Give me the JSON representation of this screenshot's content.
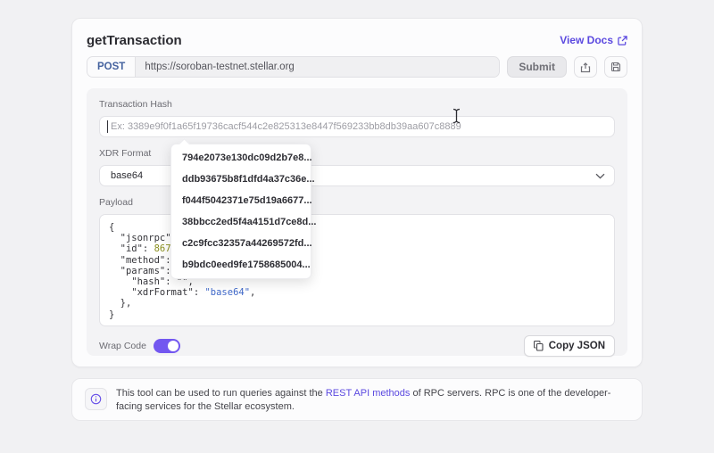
{
  "header": {
    "title": "getTransaction",
    "view_docs_label": "View Docs"
  },
  "request_bar": {
    "method": "POST",
    "url": "https://soroban-testnet.stellar.org",
    "submit_label": "Submit"
  },
  "form": {
    "transaction_hash": {
      "label": "Transaction Hash",
      "value": "",
      "placeholder": "Ex: 3389e9f0f1a65f19736cacf544c2e825313e8447f569233bb8db39aa607c8889"
    },
    "suggestions": [
      "794e2073e130dc09d2b7e8...",
      "ddb93675b8f1dfd4a37c36e...",
      "f044f5042371e75d19a6677...",
      "38bbcc2ed5f4a4151d7ce8d...",
      "c2c9fcc32357a44269572fd...",
      "b9bdc0eed9fe1758685004..."
    ],
    "xdr_format": {
      "label": "XDR Format",
      "value": "base64"
    },
    "payload": {
      "label": "Payload",
      "lines": [
        [
          {
            "c": "p",
            "v": "{"
          }
        ],
        [
          {
            "c": "p",
            "v": "  \"jsonrpc\": "
          }
        ],
        [
          {
            "c": "p",
            "v": "  \"id\": "
          },
          {
            "c": "num",
            "v": "86753"
          }
        ],
        [
          {
            "c": "p",
            "v": "  \"method\": \""
          }
        ],
        [
          {
            "c": "p",
            "v": "  \"params\": {"
          }
        ],
        [
          {
            "c": "p",
            "v": "    \"hash\": \"\","
          }
        ],
        [
          {
            "c": "p",
            "v": "    \"xdrFormat\": "
          },
          {
            "c": "str",
            "v": "\"base64\""
          },
          {
            "c": "p",
            "v": ","
          }
        ],
        [
          {
            "c": "p",
            "v": "  },"
          }
        ],
        [
          {
            "c": "p",
            "v": "}"
          }
        ]
      ]
    },
    "wrap_code_label": "Wrap Code",
    "wrap_code_on": true,
    "copy_json_label": "Copy JSON"
  },
  "footer_note": {
    "text_before_link": "This tool can be used to run queries against the ",
    "link_text": "REST API methods",
    "text_after_link": " of RPC servers. RPC is one of the developer-facing services for the Stellar ecosystem."
  },
  "colors": {
    "accent_indigo": "#5b49e0",
    "toggle_purple": "#7357f0",
    "post_blue": "#46639f",
    "code_number": "#8a8f1f",
    "code_string": "#3f68c9",
    "page_background": "#f1f1f3",
    "section_background": "#f3f3f5"
  }
}
